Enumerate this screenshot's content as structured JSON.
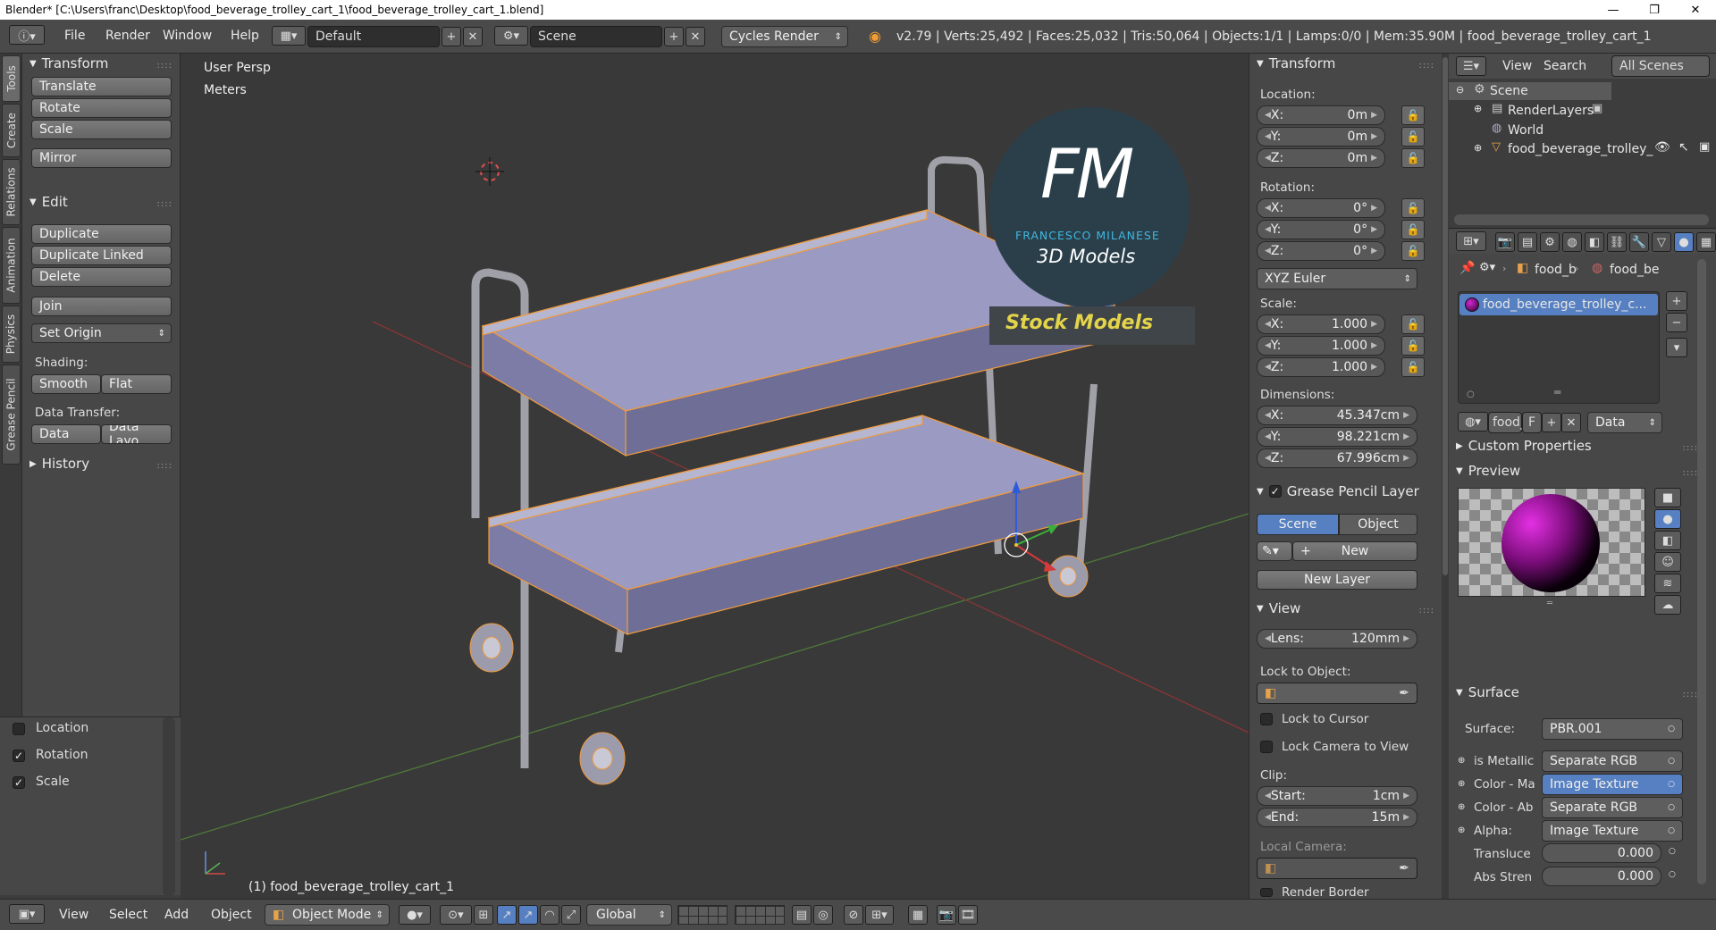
{
  "window": {
    "title": "Blender* [C:\\Users\\franc\\Desktop\\food_beverage_trolley_cart_1\\food_beverage_trolley_cart_1.blend]"
  },
  "menu": {
    "file": "File",
    "render": "Render",
    "window": "Window",
    "help": "Help"
  },
  "screen": {
    "layout": "Default",
    "scene": "Scene",
    "engine": "Cycles Render"
  },
  "stats": "v2.79 | Verts:25,492 | Faces:25,032 | Tris:50,064 | Objects:1/1 | Lamps:0/0 | Mem:35.90M | food_beverage_trolley_cart_1",
  "side_tabs": [
    "Tools",
    "Create",
    "Relations",
    "Animation",
    "Physics",
    "Grease Pencil"
  ],
  "toolshelf": {
    "transform_title": "Transform",
    "translate": "Translate",
    "rotate": "Rotate",
    "scale": "Scale",
    "mirror": "Mirror",
    "edit_title": "Edit",
    "duplicate": "Duplicate",
    "duplicate_linked": "Duplicate Linked",
    "delete": "Delete",
    "join": "Join",
    "set_origin": "Set Origin",
    "shading_label": "Shading:",
    "smooth": "Smooth",
    "flat": "Flat",
    "data_transfer_label": "Data Transfer:",
    "data": "Data",
    "data_layout": "Data Layo",
    "history_title": "History"
  },
  "operator_panel": {
    "location": "Location",
    "rotation": "Rotation",
    "scale": "Scale",
    "location_checked": false,
    "rotation_checked": true,
    "scale_checked": true
  },
  "viewport": {
    "view_name": "User Persp",
    "units": "Meters",
    "object_label": "(1) food_beverage_trolley_cart_1",
    "watermark": {
      "initials": "FM",
      "author": "FRANCESCO MILANESE",
      "subtitle": "3D Models",
      "stock": "Stock Models"
    }
  },
  "npanel": {
    "transform_title": "Transform",
    "location_label": "Location:",
    "location": {
      "x": "0m",
      "y": "0m",
      "z": "0m"
    },
    "rotation_label": "Rotation:",
    "rotation": {
      "x": "0°",
      "y": "0°",
      "z": "0°"
    },
    "rotation_mode": "XYZ Euler",
    "scale_label": "Scale:",
    "scale": {
      "x": "1.000",
      "y": "1.000",
      "z": "1.000"
    },
    "dimensions_label": "Dimensions:",
    "dimensions": {
      "x": "45.347cm",
      "y": "98.221cm",
      "z": "67.996cm"
    },
    "axis": {
      "x": "X:",
      "y": "Y:",
      "z": "Z:"
    },
    "gp_title": "Grease Pencil Layer",
    "gp_scene": "Scene",
    "gp_object": "Object",
    "gp_new": "New",
    "gp_new_layer": "New Layer",
    "view_title": "View",
    "lens_label": "Lens:",
    "lens_value": "120mm",
    "lock_object_label": "Lock to Object:",
    "lock_cursor": "Lock to Cursor",
    "lock_camera": "Lock Camera to View",
    "clip_label": "Clip:",
    "clip_start_label": "Start:",
    "clip_start": "1cm",
    "clip_end_label": "End:",
    "clip_end": "15m",
    "local_camera_label": "Local Camera:",
    "render_border": "Render Border"
  },
  "outliner": {
    "view": "View",
    "search": "Search",
    "all_scenes": "All Scenes",
    "items": [
      "Scene",
      "RenderLayers",
      "World",
      "food_beverage_trolley_"
    ]
  },
  "properties": {
    "breadcrumb": [
      "food_b",
      "food_be"
    ],
    "material_slot": "food_beverage_trolley_c...",
    "mat_name": "food_",
    "mat_f": "F",
    "mat_data": "Data",
    "custom_props": "Custom Properties",
    "preview": "Preview",
    "surface_title": "Surface",
    "surface_label": "Surface:",
    "surface_value": "PBR.001",
    "inputs": [
      {
        "label": "is Metallic",
        "value": "Separate RGB"
      },
      {
        "label": "Color - Ma",
        "value": "Image Texture"
      },
      {
        "label": "Color - Ab",
        "value": "Separate RGB"
      },
      {
        "label": "Alpha:",
        "value": "Image Texture"
      }
    ],
    "translucence_label": "Transluce",
    "translucence_value": "0.000",
    "abs_strength_label": "Abs Stren",
    "abs_strength_value": "0.000"
  },
  "bottombar": {
    "view": "View",
    "select": "Select",
    "add": "Add",
    "object": "Object",
    "mode": "Object Mode",
    "orientation": "Global"
  },
  "colors": {
    "accent_blue": "#5680c2",
    "selection_orange": "#f09a3c",
    "trolley_tray": "#8a8ab0"
  }
}
